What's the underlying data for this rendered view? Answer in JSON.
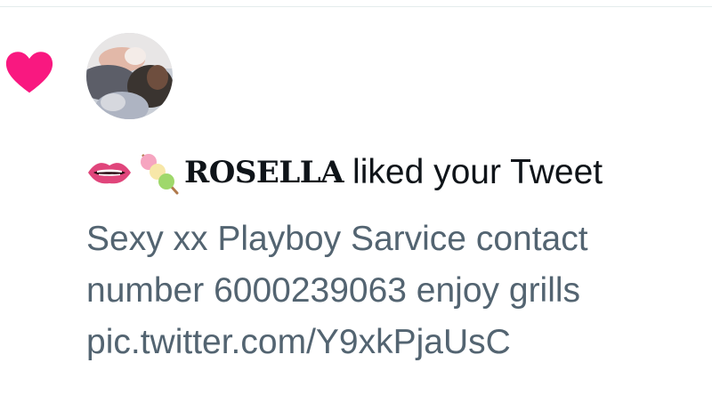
{
  "notification": {
    "type": "like",
    "user_name": "ROSELLA",
    "user_emojis": [
      "lips-emoji",
      "dango-emoji"
    ],
    "action_text": "liked your Tweet",
    "tweet_text_lines": [
      "Sexy xx Playboy Sarvice contact",
      "number 6000239063 enjoy grills",
      "pic.twitter.com/Y9xkPjaUsC"
    ],
    "icon": "heart-icon",
    "colors": {
      "heart": "#f91880",
      "name_text": "#0f1419",
      "tweet_text": "#536471",
      "divider": "#e4ecec"
    }
  }
}
